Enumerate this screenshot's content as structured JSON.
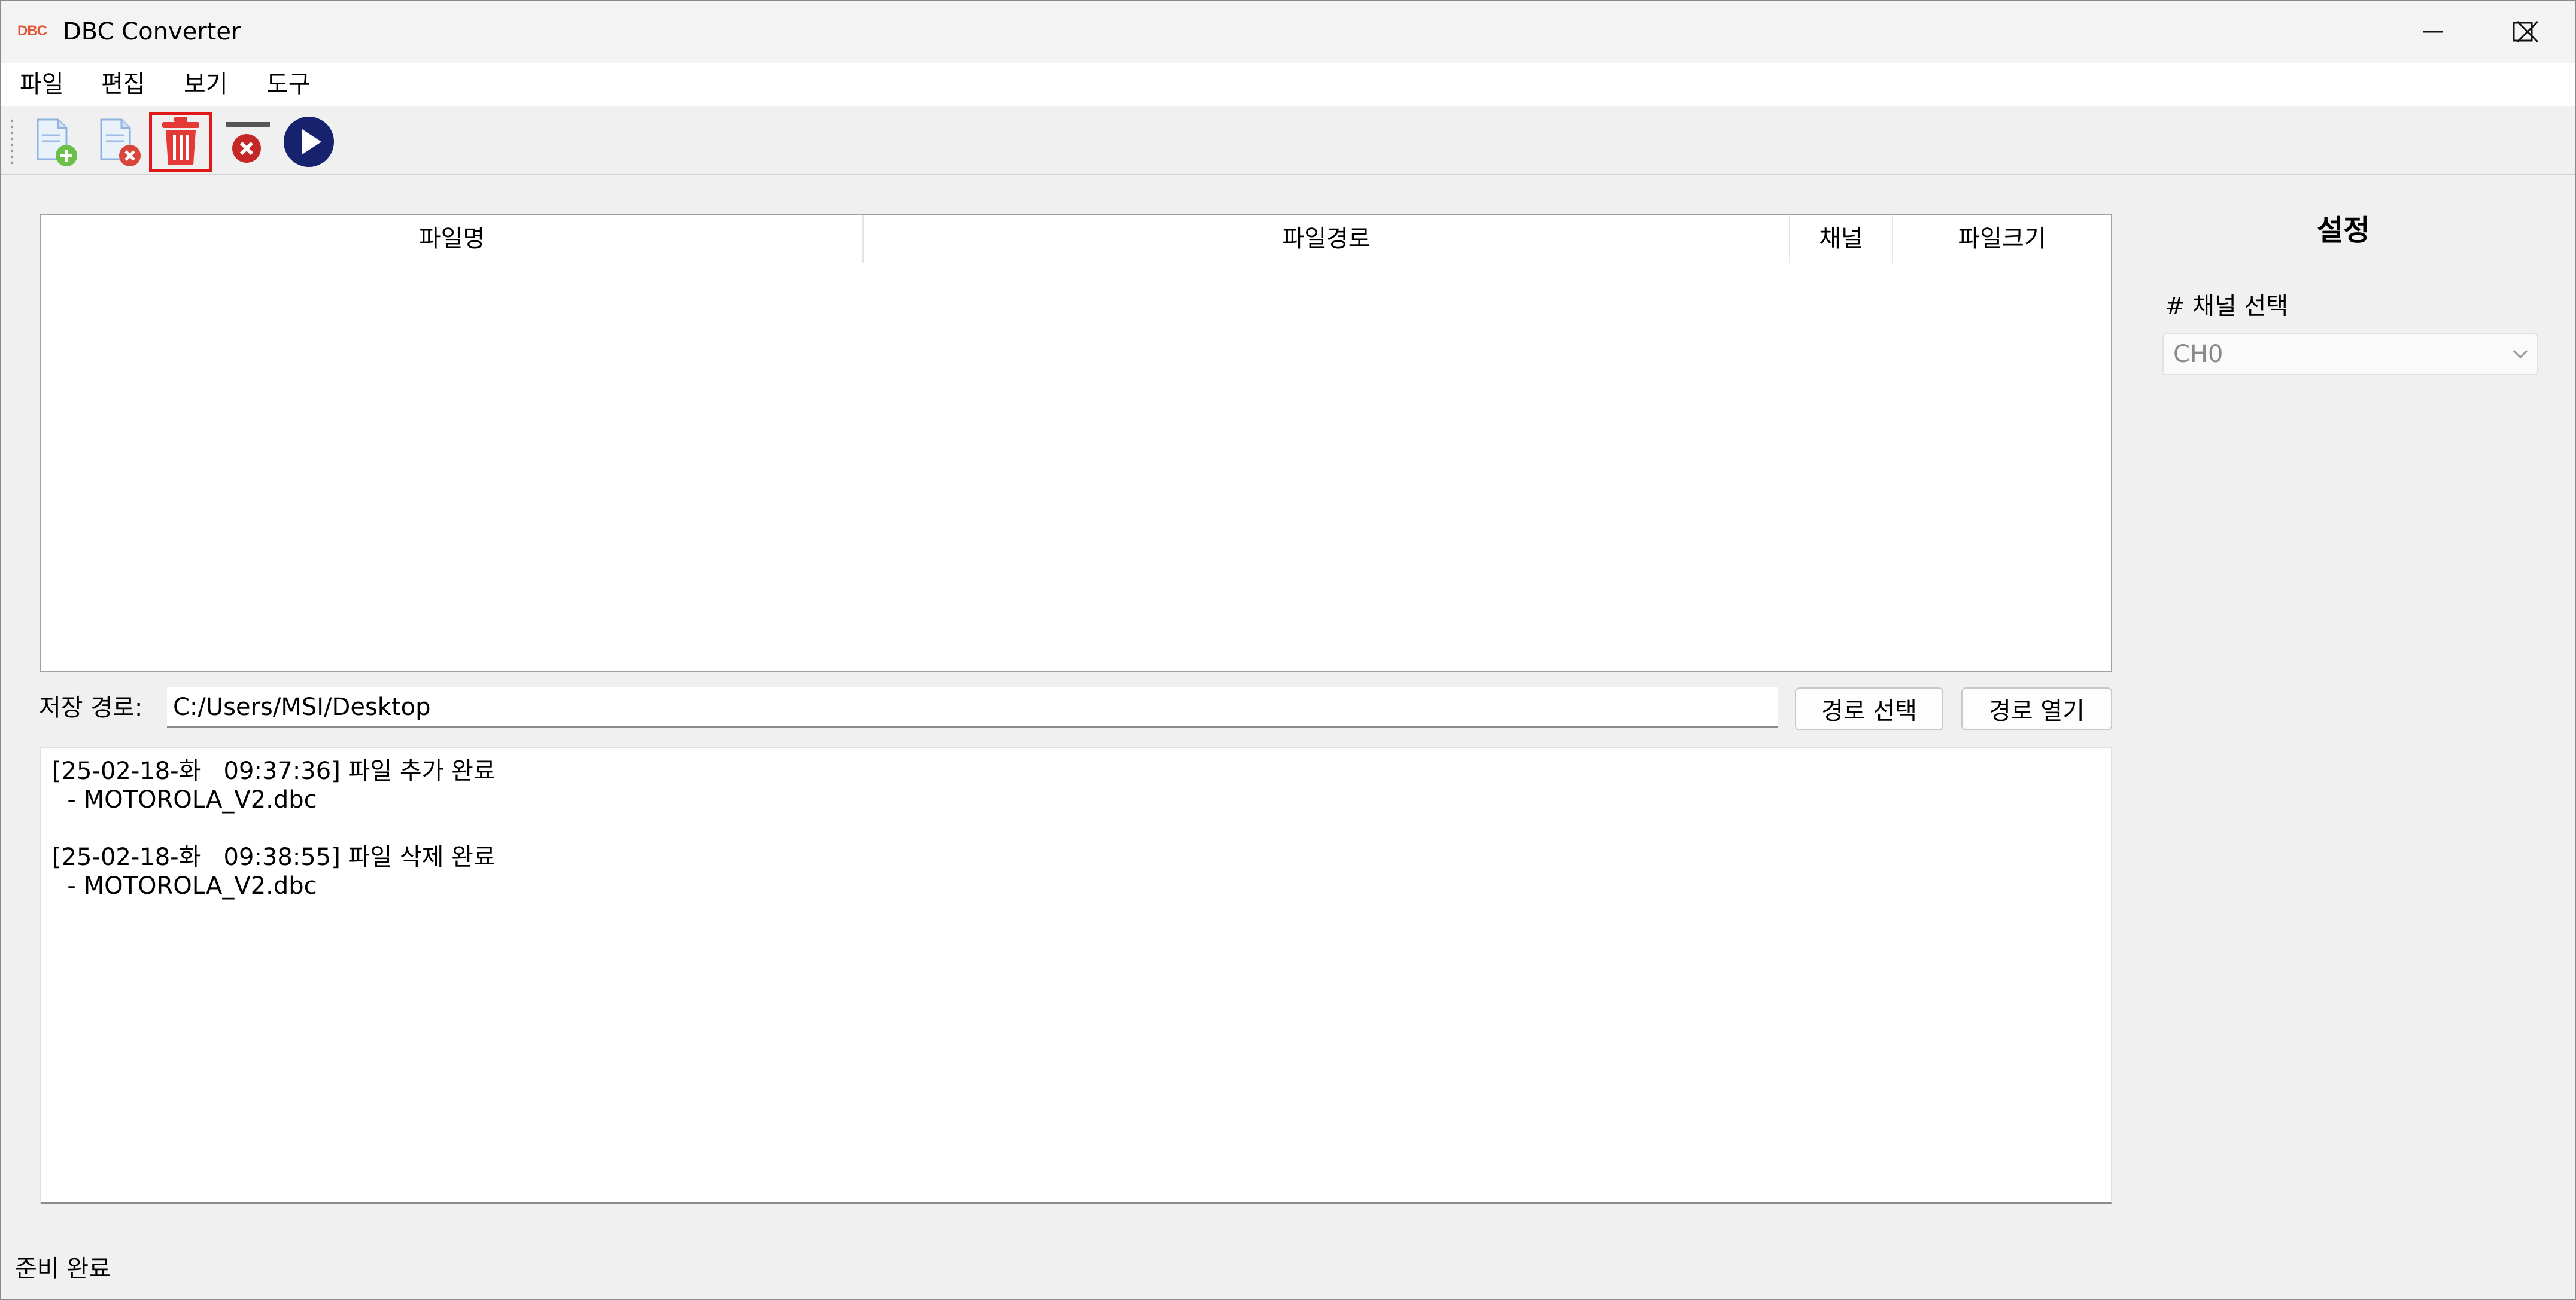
{
  "window": {
    "app_logo_text": "DBC",
    "title": "DBC Converter"
  },
  "menu": {
    "items": [
      "파일",
      "편집",
      "보기",
      "도구"
    ]
  },
  "toolbar": {
    "buttons": [
      {
        "icon": "add-file-icon",
        "color": "#6cbf4a"
      },
      {
        "icon": "remove-file-icon",
        "color": "#d9443b"
      },
      {
        "icon": "trash-icon",
        "color": "#e53935",
        "selected": true
      },
      {
        "icon": "clear-icon",
        "color": "#c62828"
      },
      {
        "icon": "play-icon",
        "color": "#16226e"
      }
    ]
  },
  "file_table": {
    "columns": [
      "파일명",
      "파일경로",
      "채널",
      "파일크기"
    ],
    "rows": []
  },
  "save_path": {
    "label": "저장 경로:",
    "value": "C:/Users/MSI/Desktop",
    "select_button": "경로 선택",
    "open_button": "경로 열기"
  },
  "log": {
    "lines": [
      "[25-02-18-화   09:37:36] 파일 추가 완료",
      "  - MOTOROLA_V2.dbc",
      "",
      "[25-02-18-화   09:38:55] 파일 삭제 완료",
      "  - MOTOROLA_V2.dbc"
    ]
  },
  "settings": {
    "title": "설정",
    "channel_label": "# 채널 선택",
    "channel_value": "CH0"
  },
  "status": {
    "text": "준비 완료"
  }
}
